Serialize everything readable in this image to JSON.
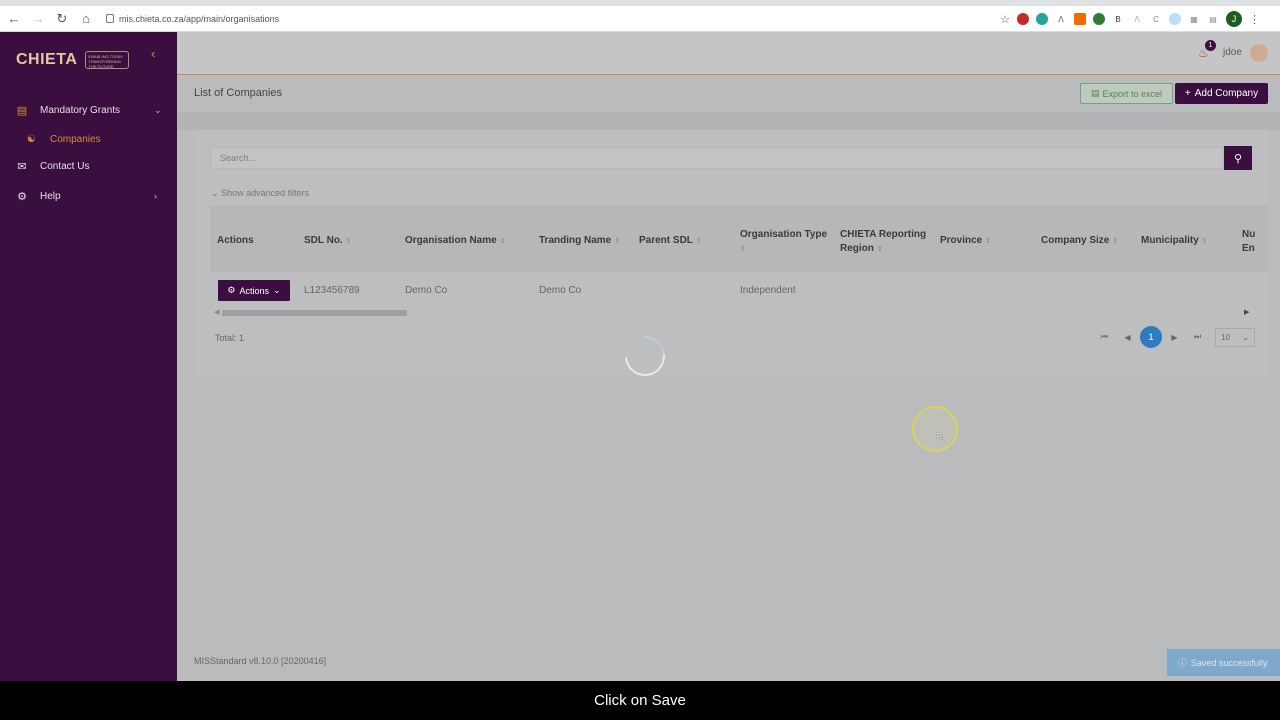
{
  "browser": {
    "url": "mis.chieta.co.za/app/main/organisations",
    "profile_initial": "J"
  },
  "sidebar": {
    "logo_text": "CHIETA",
    "logo_tagline": "ENABLING TODAY TRANSFORMING THE FUTURE",
    "items": [
      {
        "label": "Mandatory Grants",
        "icon": "grants-icon"
      },
      {
        "label": "Companies",
        "icon": "companies-icon"
      },
      {
        "label": "Contact Us",
        "icon": "contact-icon"
      },
      {
        "label": "Help",
        "icon": "help-icon"
      }
    ]
  },
  "header": {
    "notification_count": "1",
    "username": "jdoe"
  },
  "page": {
    "title": "List of Companies",
    "export_label": "Export to excel",
    "add_label": "Add Company"
  },
  "search": {
    "placeholder": "Search..."
  },
  "filters": {
    "advanced_label": "Show advanced filters"
  },
  "table": {
    "columns": [
      "Actions",
      "SDL No.",
      "Organisation Name",
      "Tranding Name",
      "Parent SDL",
      "Organisation Type",
      "CHIETA Reporting Region",
      "Province",
      "Company Size",
      "Municipality",
      "Nu En"
    ],
    "rows": [
      {
        "actions_label": "Actions",
        "sdl_no": "L123456789",
        "organisation_name": "Demo Co",
        "trading_name": "Demo Co",
        "parent_sdl": "",
        "organisation_type": "Independent"
      }
    ],
    "total": "Total: 1"
  },
  "pagination": {
    "current_page": "1",
    "page_size": "10"
  },
  "footer": {
    "version": "MISStandard v8.10.0 [20200416]"
  },
  "toast": {
    "message": "Saved successfully."
  },
  "caption": "Click on Save",
  "colors": {
    "brand_purple": "#3a0f3f",
    "accent_orange": "#d98a3b",
    "pager_blue": "#2f7ac0",
    "export_green": "#4c8a56"
  }
}
